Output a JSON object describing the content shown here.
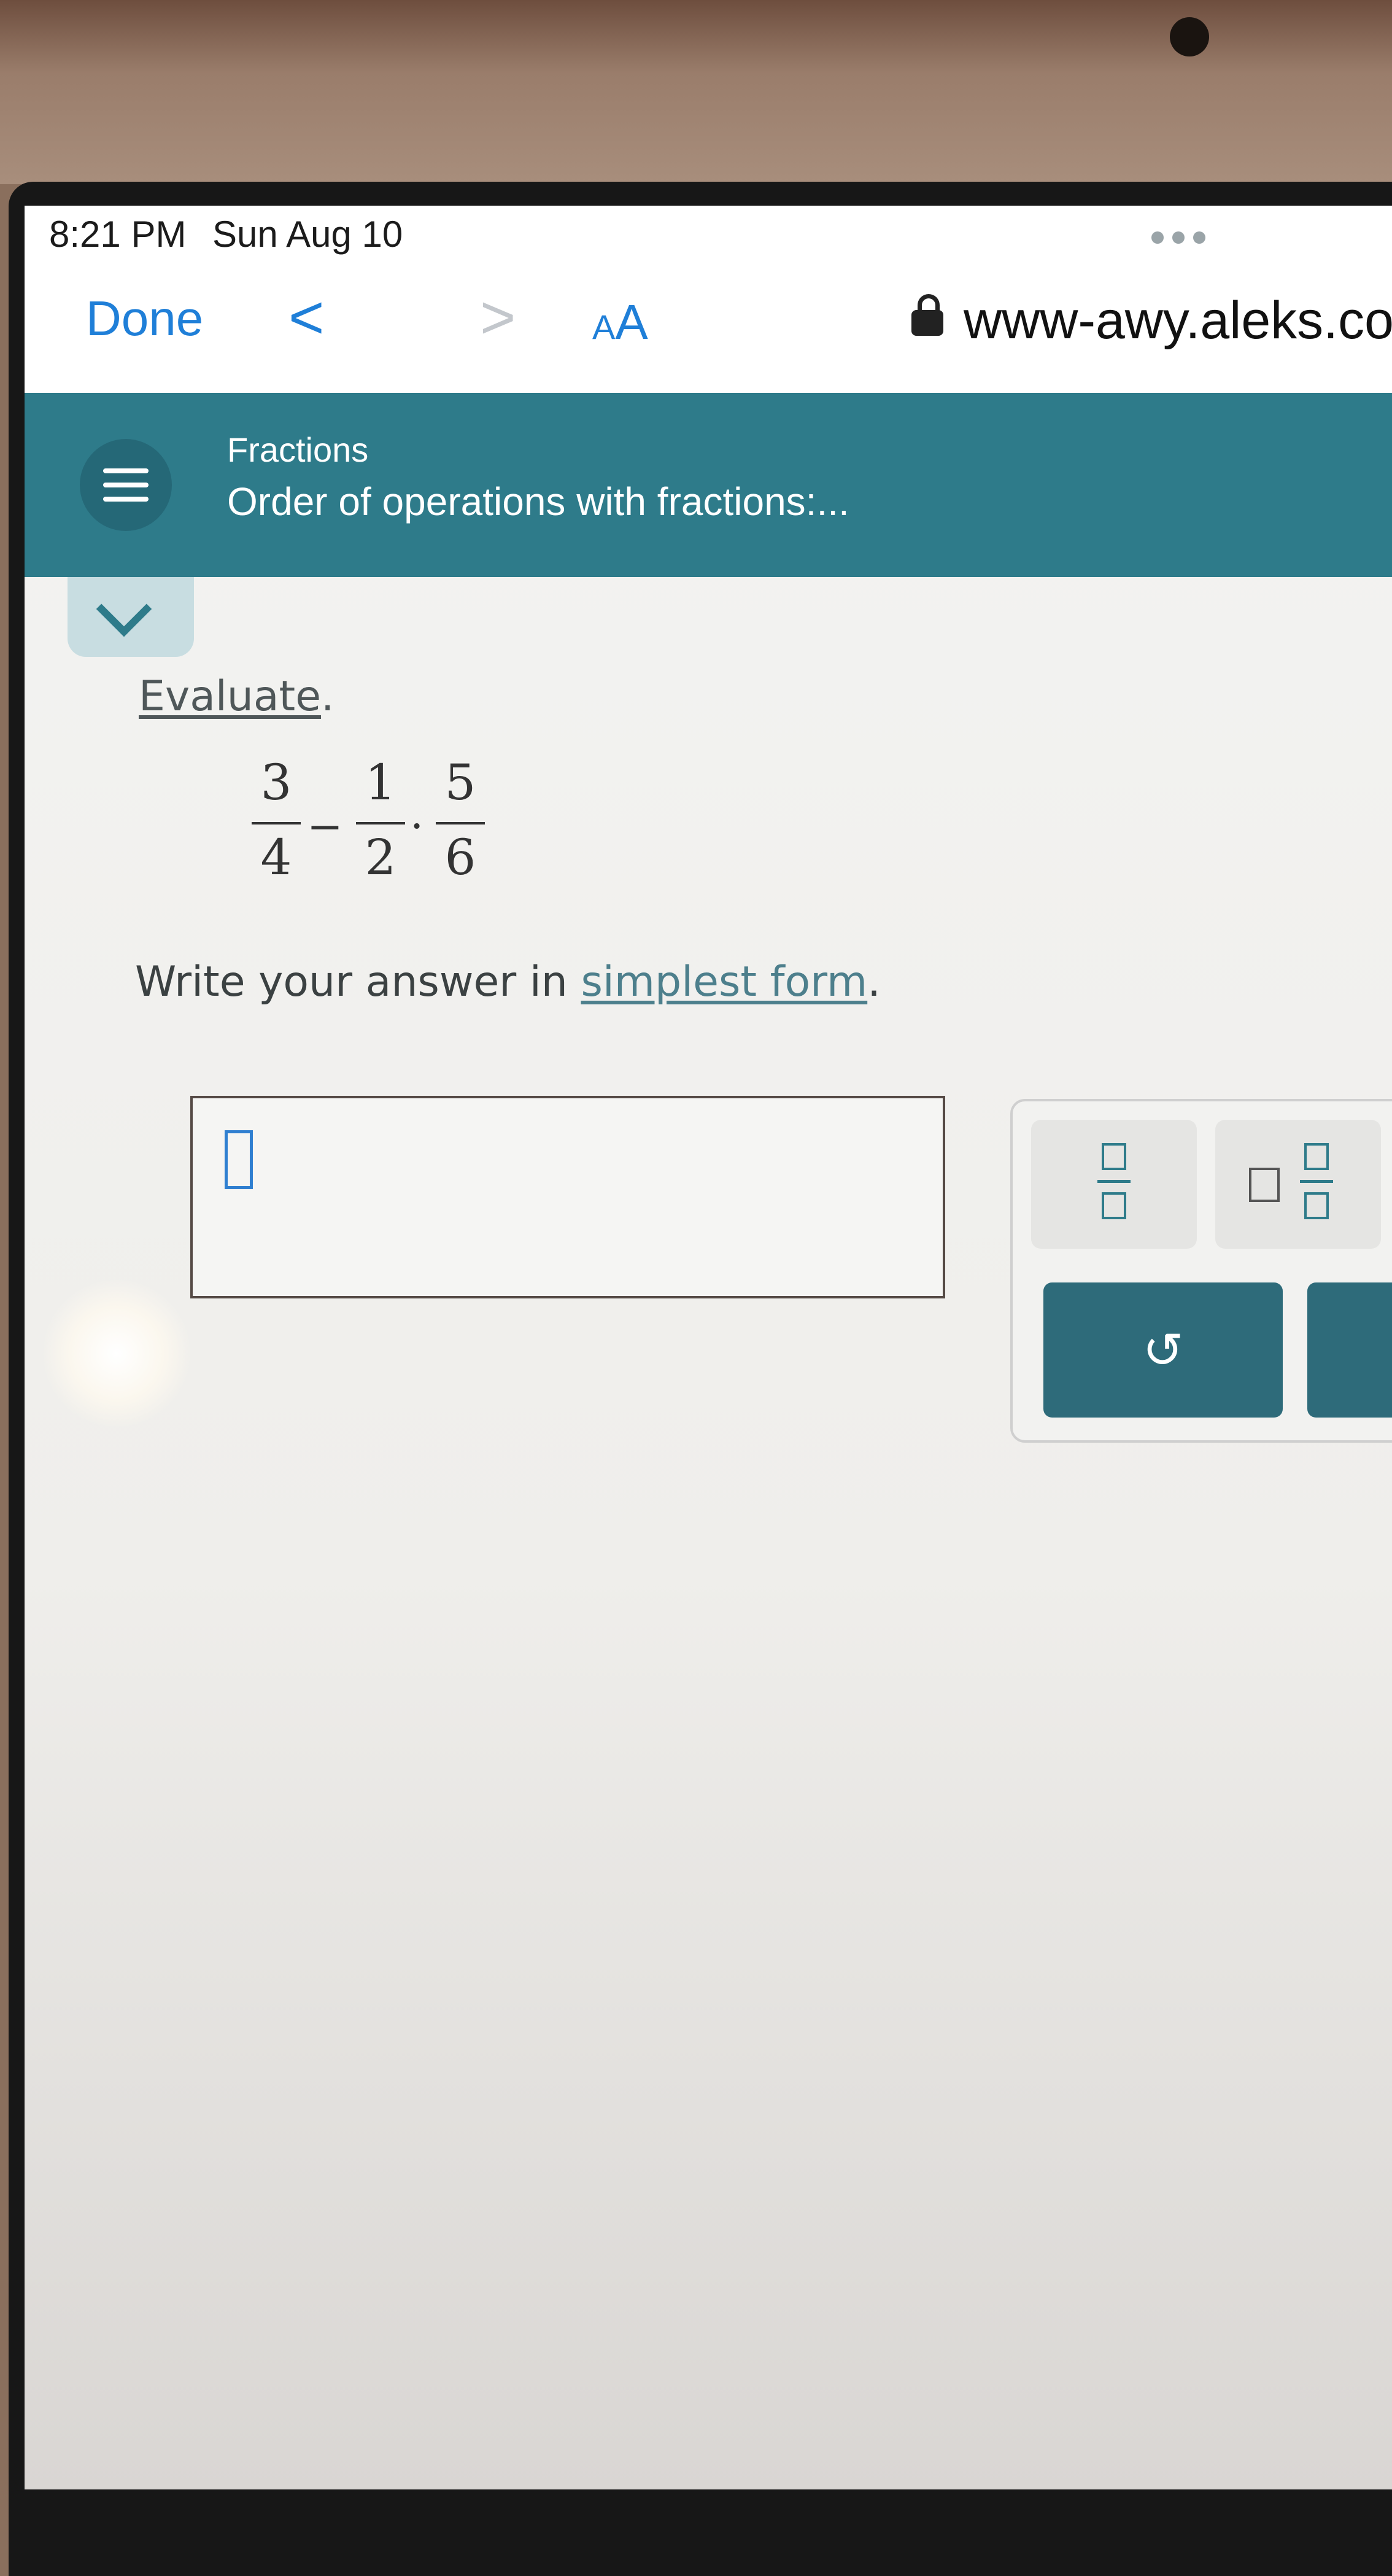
{
  "status": {
    "time": "8:21 PM",
    "date": "Sun Aug 10"
  },
  "browser": {
    "done_label": "Done",
    "back_glyph": "<",
    "forward_glyph": ">",
    "text_size_small": "A",
    "text_size_big": "A",
    "url": "www-awy.aleks.com"
  },
  "header": {
    "topic": "Fractions",
    "subtopic": "Order of operations with fractions:..."
  },
  "problem": {
    "prompt_word": "Evaluate",
    "prompt_period": ".",
    "expression": {
      "term1": {
        "num": "3",
        "den": "4"
      },
      "op1": "−",
      "term2": {
        "num": "1",
        "den": "2"
      },
      "op2": "·",
      "term3": {
        "num": "5",
        "den": "6"
      }
    },
    "instruction_prefix": "Write your answer in ",
    "instruction_link": "simplest form",
    "instruction_suffix": "."
  },
  "answer": {
    "value": ""
  },
  "keypad": {
    "fraction_key": "fraction-icon",
    "mixed_number_key": "mixed-number-icon",
    "undo_glyph": "↺"
  },
  "colors": {
    "accent": "#2e7b8a",
    "link_blue": "#1f7fd8"
  }
}
